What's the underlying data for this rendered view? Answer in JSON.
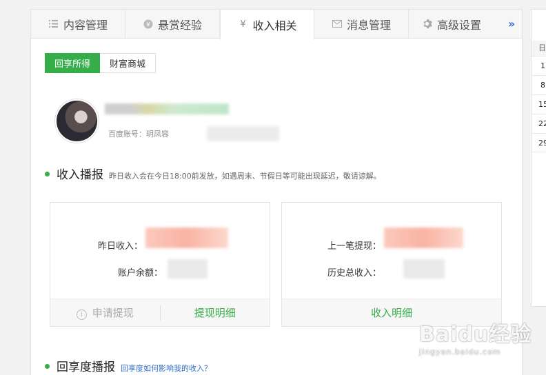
{
  "tabs": [
    {
      "label": "内容管理",
      "icon": "list-icon"
    },
    {
      "label": "悬赏经验",
      "icon": "coin-icon"
    },
    {
      "label": "收入相关",
      "icon": "yen-icon"
    },
    {
      "label": "消息管理",
      "icon": "mail-icon"
    },
    {
      "label": "高级设置",
      "icon": "gear-icon"
    }
  ],
  "tab_more": "»",
  "subtabs": {
    "active": "回享所得",
    "other": "财富商城"
  },
  "user": {
    "account_label": "百度账号：玥凤容"
  },
  "income_section": {
    "title": "收入播报",
    "note": "昨日收入会在今日18:00前发放，如遇周末、节假日等可能出现延迟，敬请谅解。"
  },
  "card_left": {
    "row1_label": "昨日收入：",
    "row2_label": "账户余额：",
    "btn_apply": "申请提现",
    "btn_detail": "提现明细"
  },
  "card_right": {
    "row1_label": "上一笔提现：",
    "row2_label": "历史总收入：",
    "btn_detail": "收入明细"
  },
  "share_section": {
    "title": "回享度播报",
    "link": "回享度如何影响我的收入？"
  },
  "calendar": {
    "header": "日",
    "days": [
      "1",
      "8",
      "15",
      "22",
      "29"
    ]
  },
  "watermark": {
    "main": "Baidu经验",
    "sub": "jingyan.baidu.com"
  },
  "colors": {
    "accent": "#35ad49",
    "link": "#2f6bc9"
  }
}
